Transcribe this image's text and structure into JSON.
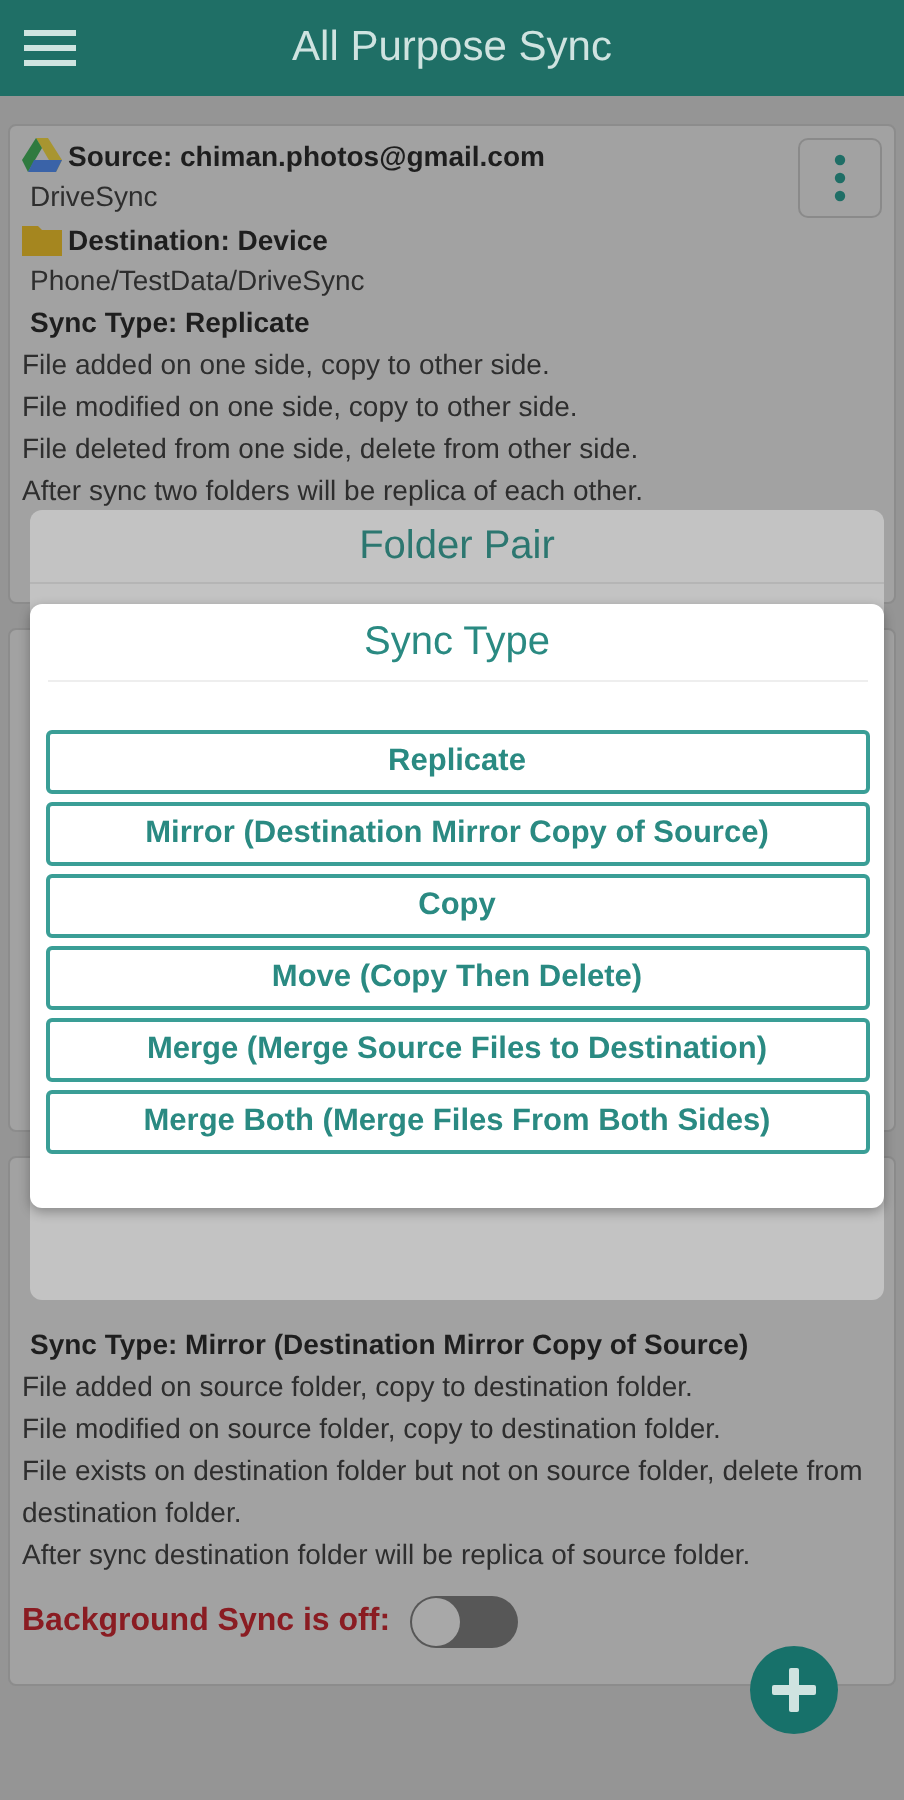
{
  "app_bar": {
    "title": "All Purpose Sync"
  },
  "folder_pairs": [
    {
      "source": "Source: chiman.photos@gmail.com",
      "source_folder": "DriveSync",
      "destination": "Destination: Device",
      "destination_folder": "Phone/TestData/DriveSync",
      "sync_type": "Sync Type: Replicate",
      "descriptions": [
        "File added on one side, copy to other side.",
        "File modified on one side, copy to other side.",
        "File deleted from one side, delete from other side.",
        "After sync two folders will be replica of each other."
      ]
    },
    {
      "sync_type": "Sync Type: Mirror (Destination Mirror Copy of Source)",
      "descriptions": [
        "File added on source folder, copy to destination folder.",
        "File modified on source folder, copy to destination folder.",
        "File exists on destination folder but not on source folder, delete from destination folder.",
        "After sync destination folder will be replica of source folder."
      ],
      "background_sync": {
        "label": "Background Sync is off:",
        "on": false
      }
    }
  ],
  "folder_pair_dialog": {
    "title": "Folder Pair"
  },
  "sync_type_dialog": {
    "title": "Sync Type",
    "options": [
      "Replicate",
      "Mirror (Destination Mirror Copy of Source)",
      "Copy",
      "Move (Copy Then Delete)",
      "Merge (Merge Source Files to Destination)",
      "Merge Both (Merge Files From Both Sides)"
    ]
  }
}
